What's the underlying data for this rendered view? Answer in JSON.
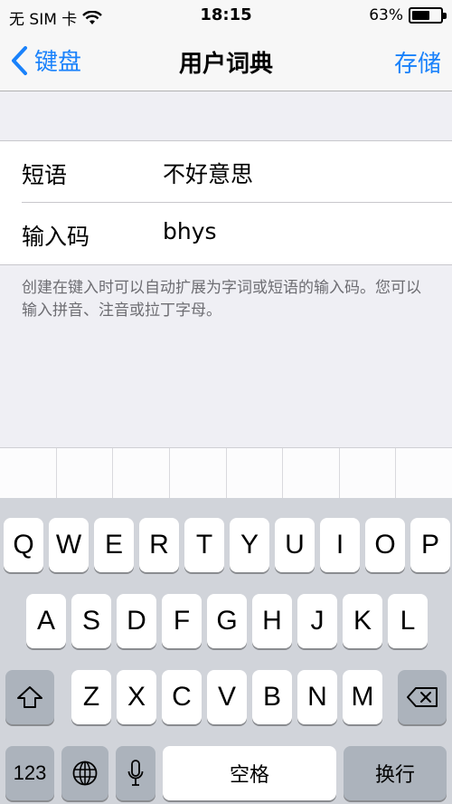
{
  "status": {
    "carrier": "无 SIM 卡",
    "time": "18:15",
    "battery": "63%",
    "battery_level": 0.63
  },
  "nav": {
    "back_label": "键盘",
    "title": "用户词典",
    "save_label": "存储"
  },
  "form": {
    "phrase_label": "短语",
    "phrase_value": "不好意思",
    "shortcut_label": "输入码",
    "shortcut_value": "bhys"
  },
  "footnote": "创建在键入时可以自动扩展为字词或短语的输入码。您可以输入拼音、注音或拉丁字母。",
  "keyboard": {
    "row1": [
      "Q",
      "W",
      "E",
      "R",
      "T",
      "Y",
      "U",
      "I",
      "O",
      "P"
    ],
    "row2": [
      "A",
      "S",
      "D",
      "F",
      "G",
      "H",
      "J",
      "K",
      "L"
    ],
    "row3": [
      "Z",
      "X",
      "C",
      "V",
      "B",
      "N",
      "M"
    ],
    "numbers_label": "123",
    "space_label": "空格",
    "return_label": "换行"
  },
  "icons": {
    "back": "chevron-left-icon",
    "wifi": "wifi-icon",
    "battery": "battery-icon",
    "shift": "shift-icon",
    "delete": "delete-icon",
    "globe": "globe-icon",
    "mic": "microphone-icon"
  },
  "colors": {
    "accent": "#1a82fb",
    "keyboard_bg": "#d1d4da",
    "dark_key": "#acb3bc"
  }
}
